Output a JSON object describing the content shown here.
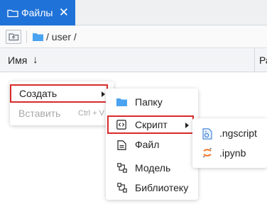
{
  "tab": {
    "title": "Файлы",
    "close": "✕"
  },
  "path": {
    "text": "/ user /"
  },
  "columns": {
    "name": "Имя",
    "sort_arrow": "↓",
    "partial": "Ра"
  },
  "context_menu": {
    "create": "Создать",
    "paste": "Вставить",
    "paste_shortcut": "Ctrl + V"
  },
  "create_submenu": {
    "folder": "Папку",
    "script": "Скрипт",
    "file": "Файл",
    "model": "Модель",
    "library": "Библиотеку"
  },
  "script_submenu": {
    "ngscript": ".ngscript",
    "ipynb": ".ipynb"
  },
  "colors": {
    "accent": "#1f72d8",
    "highlight": "#d92a2a",
    "folder": "#4aa3f0",
    "jupyter": "#f37726"
  }
}
